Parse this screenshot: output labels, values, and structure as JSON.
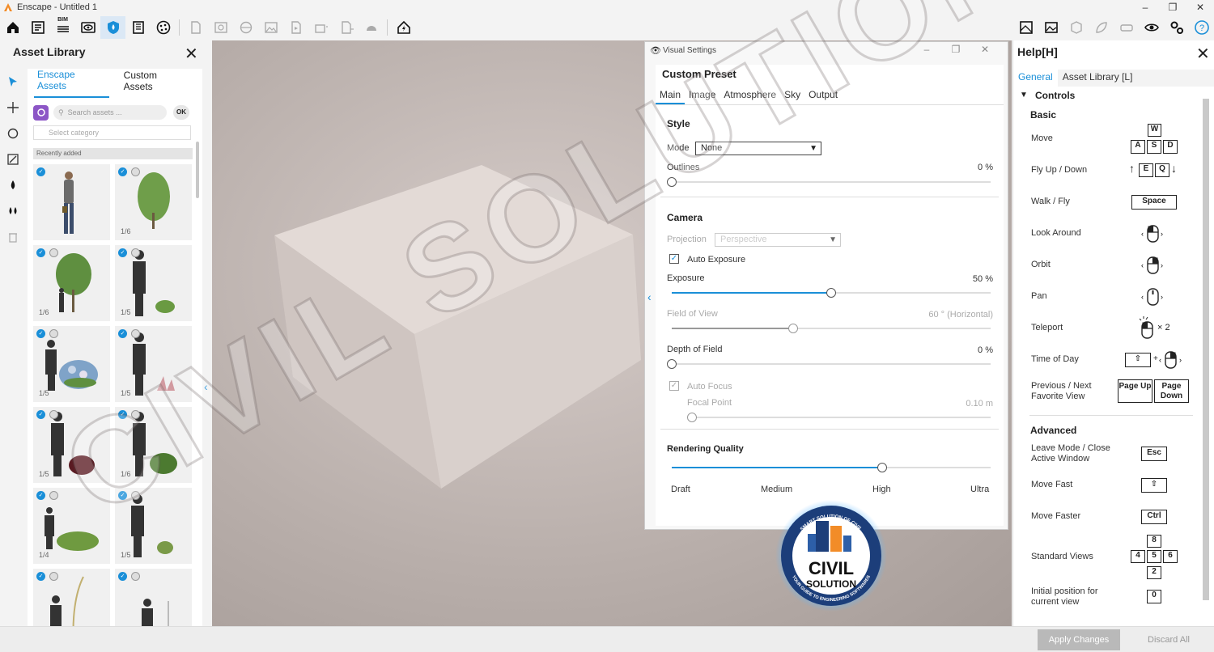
{
  "window": {
    "title": "Enscape - Untitled 1",
    "minimize": "–",
    "maximize": "❐",
    "close": "✕"
  },
  "toolbar": {
    "bim_label": "BIM",
    "collapse_glyph": "⌃"
  },
  "asset_library": {
    "title": "Asset Library",
    "close": "✕",
    "tabs": [
      "Enscape Assets",
      "Custom Assets"
    ],
    "search_placeholder": "Search assets ...",
    "ok_label": "OK",
    "category_placeholder": "Select category",
    "recently_added": "Recently added",
    "tiles": [
      {
        "count": ""
      },
      {
        "count": "1/6"
      },
      {
        "count": "1/6"
      },
      {
        "count": "1/5"
      },
      {
        "count": "1/5"
      },
      {
        "count": "1/5"
      },
      {
        "count": "1/5"
      },
      {
        "count": "1/6"
      },
      {
        "count": "1/4"
      },
      {
        "count": "1/5"
      },
      {
        "count": ""
      },
      {
        "count": ""
      }
    ]
  },
  "visual_settings": {
    "window_title": "Visual Settings",
    "preset": "Custom Preset",
    "tabs": [
      "Main",
      "Image",
      "Atmosphere",
      "Sky",
      "Output"
    ],
    "style": {
      "heading": "Style",
      "mode_label": "Mode",
      "mode_value": "None",
      "outlines_label": "Outlines",
      "outlines_value": "0 %",
      "outlines_fraction": 0.0
    },
    "camera": {
      "heading": "Camera",
      "projection_label": "Projection",
      "projection_value": "Perspective",
      "auto_exposure_label": "Auto Exposure",
      "auto_exposure_checked": true,
      "exposure_label": "Exposure",
      "exposure_value": "50 %",
      "exposure_fraction": 0.5,
      "fov_label": "Field of View",
      "fov_value": "60 ° (Horizontal)",
      "fov_fraction": 0.38,
      "dof_label": "Depth of Field",
      "dof_value": "0 %",
      "dof_fraction": 0.0,
      "auto_focus_label": "Auto Focus",
      "focal_point_label": "Focal Point",
      "focal_point_value": "0.10 m",
      "focal_point_fraction": 0.0
    },
    "rendering_quality": {
      "heading": "Rendering Quality",
      "fraction": 0.66,
      "levels": [
        "Draft",
        "Medium",
        "High",
        "Ultra"
      ]
    }
  },
  "help": {
    "title": "Help[H]",
    "close": "✕",
    "tabs": [
      "General",
      "Asset Library [L]"
    ],
    "controls_heading": "Controls",
    "basic_heading": "Basic",
    "advanced_heading": "Advanced",
    "basic": [
      {
        "label": "Move",
        "keys": [
          "W",
          "A",
          "S",
          "D"
        ]
      },
      {
        "label": "Fly Up / Down",
        "keys": [
          "E",
          "Q"
        ]
      },
      {
        "label": "Walk / Fly",
        "keys": [
          "Space"
        ]
      },
      {
        "label": "Look Around"
      },
      {
        "label": "Orbit"
      },
      {
        "label": "Pan"
      },
      {
        "label": "Teleport",
        "suffix": "× 2"
      },
      {
        "label": "Time of Day"
      },
      {
        "label": "Previous / Next Favorite View",
        "keys": [
          "Page Up",
          "Page Down"
        ]
      }
    ],
    "advanced": [
      {
        "label": "Leave Mode / Close Active Window",
        "keys": [
          "Esc"
        ]
      },
      {
        "label": "Move Fast"
      },
      {
        "label": "Move Faster",
        "keys": [
          "Ctrl"
        ]
      },
      {
        "label": "Standard Views",
        "keys": [
          "8",
          "4",
          "5",
          "6",
          "2"
        ]
      },
      {
        "label": "Initial position for current view",
        "keys": [
          "0"
        ]
      }
    ],
    "plus_sign": "+"
  },
  "bottom": {
    "apply": "Apply Changes",
    "discard": "Discard All"
  },
  "watermark": {
    "text": "CIVIL SOLUTION",
    "badge_top": "SMART SOLUTION OF CIVIL",
    "badge_line1": "CIVIL",
    "badge_line2": "SOLUTION",
    "badge_bottom": "YOUR GUIDE TO ENGINEERING SOFTWARES"
  },
  "colors": {
    "accent": "#1a8fd8",
    "badge_blue": "#1c3e7a",
    "badge_orange": "#f28c28"
  }
}
